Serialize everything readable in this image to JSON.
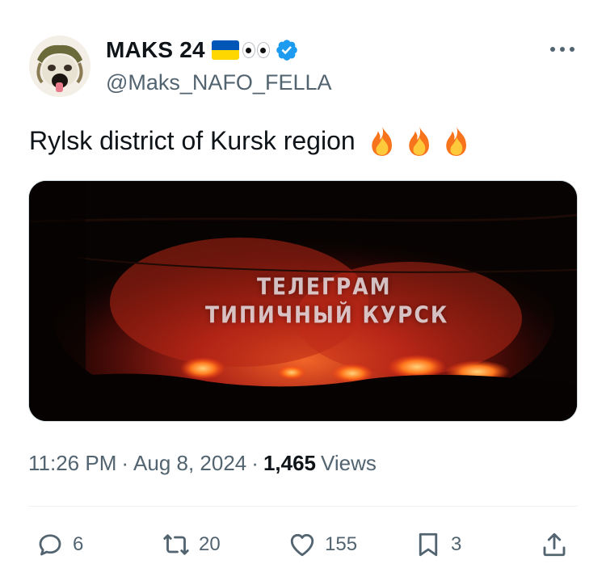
{
  "author": {
    "display_name": "MAKS 24",
    "handle": "@Maks_NAFO_FELLA",
    "badge": "verified-blue",
    "name_emojis": [
      "ukraine-flag",
      "eyes"
    ]
  },
  "tweet": {
    "text": "Rylsk district of Kursk region",
    "emojis": [
      "fire-icon",
      "fire-icon",
      "fire-icon"
    ]
  },
  "media": {
    "overlay_line1": "ТЕЛЕГРАМ",
    "overlay_line2": "ТИПИЧНЫЙ КУРСК"
  },
  "meta": {
    "time": "11:26 PM",
    "sep1": "·",
    "date": "Aug 8, 2024",
    "sep2": "·",
    "views_count": "1,465",
    "views_label": "Views"
  },
  "actions": {
    "replies": "6",
    "reposts": "20",
    "likes": "155",
    "bookmarks": "3"
  },
  "colors": {
    "text": "#0f1419",
    "secondary": "#536471",
    "verified": "#1d9bf0",
    "flag_blue": "#0057b7",
    "flag_yellow": "#ffd700"
  }
}
